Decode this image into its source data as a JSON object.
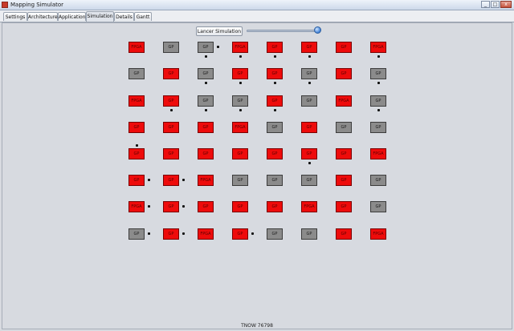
{
  "window": {
    "title": "Mapping Simulator",
    "controls": [
      "_",
      "□",
      "x"
    ]
  },
  "tabs": [
    {
      "label": "Settings",
      "active": false
    },
    {
      "label": "Architecture",
      "active": false
    },
    {
      "label": "Application",
      "active": false
    },
    {
      "label": "Simulation",
      "active": true
    },
    {
      "label": "Details",
      "active": false
    },
    {
      "label": "Gantt",
      "active": false
    }
  ],
  "simulation": {
    "launch_label": "Lancer Simulation",
    "slider_value_fraction": 0.95,
    "colors": {
      "red": "#ee0b0b",
      "gray": "#8b8b8b",
      "background": "#d7dae0"
    },
    "grid": [
      [
        {
          "l": "FPGA",
          "c": "red"
        },
        {
          "l": "GP",
          "c": "gray"
        },
        {
          "l": "GP",
          "c": "gray"
        },
        {
          "l": "FPGA",
          "c": "red"
        },
        {
          "l": "GP",
          "c": "red"
        },
        {
          "l": "GP",
          "c": "red"
        },
        {
          "l": "GP",
          "c": "red"
        },
        {
          "l": "FPGA",
          "c": "red"
        }
      ],
      [
        {
          "l": "GP",
          "c": "gray"
        },
        {
          "l": "GP",
          "c": "red"
        },
        {
          "l": "GP",
          "c": "gray"
        },
        {
          "l": "GP",
          "c": "red"
        },
        {
          "l": "GP",
          "c": "red"
        },
        {
          "l": "GP",
          "c": "gray"
        },
        {
          "l": "GP",
          "c": "red"
        },
        {
          "l": "GP",
          "c": "gray"
        }
      ],
      [
        {
          "l": "FPGA",
          "c": "red"
        },
        {
          "l": "GP",
          "c": "red"
        },
        {
          "l": "GP",
          "c": "gray"
        },
        {
          "l": "GP",
          "c": "gray"
        },
        {
          "l": "GP",
          "c": "red"
        },
        {
          "l": "GP",
          "c": "gray"
        },
        {
          "l": "FPGA",
          "c": "red"
        },
        {
          "l": "GP",
          "c": "gray"
        }
      ],
      [
        {
          "l": "GP",
          "c": "red"
        },
        {
          "l": "GP",
          "c": "red"
        },
        {
          "l": "GP",
          "c": "red"
        },
        {
          "l": "FPGA",
          "c": "red"
        },
        {
          "l": "GP",
          "c": "gray"
        },
        {
          "l": "GP",
          "c": "red"
        },
        {
          "l": "GP",
          "c": "gray"
        },
        {
          "l": "GP",
          "c": "gray"
        }
      ],
      [
        {
          "l": "GP",
          "c": "red"
        },
        {
          "l": "GP",
          "c": "red"
        },
        {
          "l": "GP",
          "c": "red"
        },
        {
          "l": "GP",
          "c": "red"
        },
        {
          "l": "GP",
          "c": "red"
        },
        {
          "l": "GP",
          "c": "red"
        },
        {
          "l": "GP",
          "c": "red"
        },
        {
          "l": "FPGA",
          "c": "red"
        }
      ],
      [
        {
          "l": "GP",
          "c": "red"
        },
        {
          "l": "GP",
          "c": "red"
        },
        {
          "l": "FPGA",
          "c": "red"
        },
        {
          "l": "GP",
          "c": "gray"
        },
        {
          "l": "GP",
          "c": "gray"
        },
        {
          "l": "GP",
          "c": "gray"
        },
        {
          "l": "GP",
          "c": "red"
        },
        {
          "l": "GP",
          "c": "gray"
        }
      ],
      [
        {
          "l": "FPGA",
          "c": "red"
        },
        {
          "l": "GP",
          "c": "red"
        },
        {
          "l": "GP",
          "c": "red"
        },
        {
          "l": "GP",
          "c": "red"
        },
        {
          "l": "GP",
          "c": "red"
        },
        {
          "l": "FPGA",
          "c": "red"
        },
        {
          "l": "GP",
          "c": "red"
        },
        {
          "l": "GP",
          "c": "gray"
        }
      ],
      [
        {
          "l": "GP",
          "c": "gray"
        },
        {
          "l": "GP",
          "c": "red"
        },
        {
          "l": "FPGA",
          "c": "red"
        },
        {
          "l": "GP",
          "c": "red"
        },
        {
          "l": "GP",
          "c": "gray"
        },
        {
          "l": "GP",
          "c": "gray"
        },
        {
          "l": "GP",
          "c": "red"
        },
        {
          "l": "FPGA",
          "c": "red"
        }
      ]
    ],
    "tokens": [
      {
        "row": 0,
        "col": 2,
        "side": "right"
      },
      {
        "row": 0,
        "col": 2,
        "side": "below"
      },
      {
        "row": 0,
        "col": 3,
        "side": "below"
      },
      {
        "row": 0,
        "col": 4,
        "side": "below"
      },
      {
        "row": 0,
        "col": 5,
        "side": "below"
      },
      {
        "row": 0,
        "col": 7,
        "side": "below"
      },
      {
        "row": 1,
        "col": 2,
        "side": "below"
      },
      {
        "row": 1,
        "col": 3,
        "side": "below"
      },
      {
        "row": 1,
        "col": 4,
        "side": "below"
      },
      {
        "row": 1,
        "col": 5,
        "side": "below"
      },
      {
        "row": 1,
        "col": 7,
        "side": "below"
      },
      {
        "row": 2,
        "col": 1,
        "side": "below"
      },
      {
        "row": 2,
        "col": 2,
        "side": "below"
      },
      {
        "row": 2,
        "col": 3,
        "side": "below"
      },
      {
        "row": 2,
        "col": 4,
        "side": "below"
      },
      {
        "row": 2,
        "col": 7,
        "side": "below"
      },
      {
        "row": 4,
        "col": 0,
        "side": "above"
      },
      {
        "row": 4,
        "col": 5,
        "side": "below"
      },
      {
        "row": 5,
        "col": 0,
        "side": "right"
      },
      {
        "row": 5,
        "col": 1,
        "side": "right"
      },
      {
        "row": 6,
        "col": 0,
        "side": "right"
      },
      {
        "row": 6,
        "col": 1,
        "side": "right"
      },
      {
        "row": 7,
        "col": 0,
        "side": "right"
      },
      {
        "row": 7,
        "col": 1,
        "side": "right"
      },
      {
        "row": 7,
        "col": 3,
        "side": "right"
      }
    ]
  },
  "status": {
    "text": "TNOW   76798"
  }
}
